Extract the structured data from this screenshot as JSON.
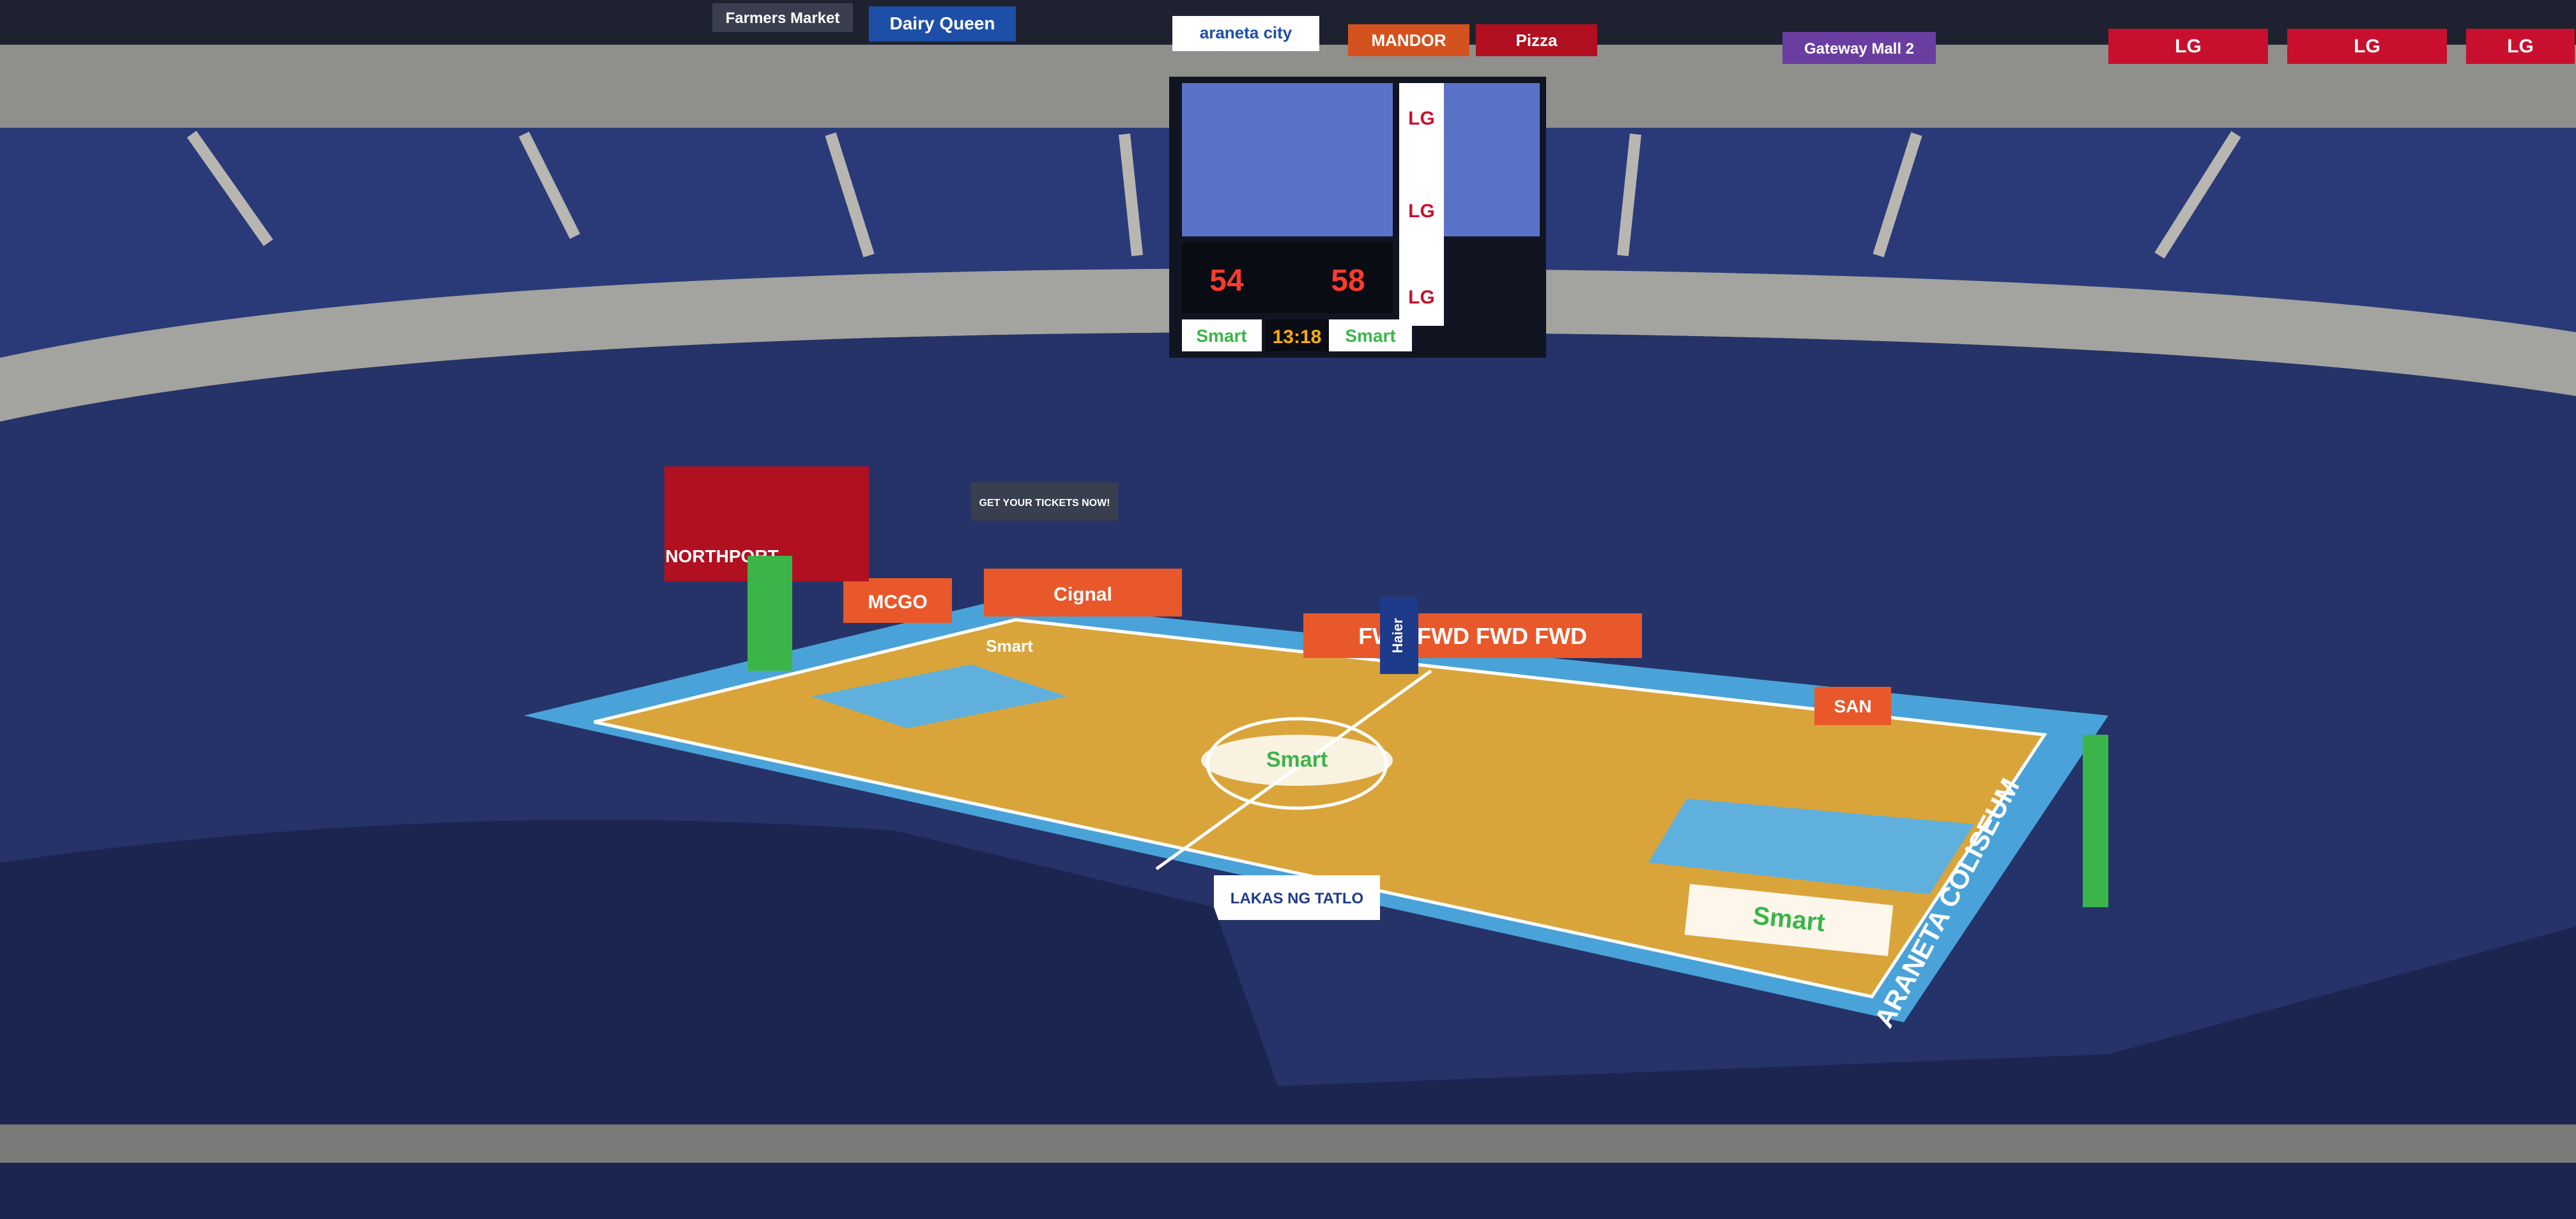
{
  "sponsor_signs": {
    "farmers_market": "Farmers Market",
    "dairy_queen": "Dairy Queen",
    "araneta_city": "araneta city",
    "mandor": "MANDOR",
    "pizza": "Pizza",
    "gateway": "Gateway Mall 2",
    "lg_1": "LG",
    "lg_2": "LG",
    "lg_3": "LG"
  },
  "scoreboard": {
    "brand_top": "LG",
    "brand_mid": "LG",
    "brand_bottom": "LG",
    "score_left": "54",
    "score_right": "58",
    "clock": "13:18",
    "sponsor_left": "Smart",
    "sponsor_right": "Smart"
  },
  "court": {
    "center_logo": "Smart",
    "baseline_logo": "Smart",
    "left_key_logo": "Smart",
    "sideline_text": "ARANETA COLISEUM",
    "baseline_sponsor": "Smart",
    "fwd_sign": "FWD FWD FWD FWD",
    "fwd_small": "FWD",
    "haier_sign": "Haier",
    "mcgo_sign": "MCGO",
    "cignal_sign": "Cignal",
    "table_sign": "LAKAS NG TATLO",
    "videoboard_left": "NORTHPORT",
    "tickets_sign": "GET YOUR TICKETS NOW!",
    "right_sign": "SAN"
  },
  "colors": {
    "court_wood": "#d9a53a",
    "court_border": "#4aa3d8",
    "paint": "#5fb0dc",
    "seats": "#2a3a78",
    "concrete": "#9a9a96",
    "smart_green": "#3bb54a",
    "fwd_orange": "#e8582a",
    "lg_red": "#c8102e"
  }
}
